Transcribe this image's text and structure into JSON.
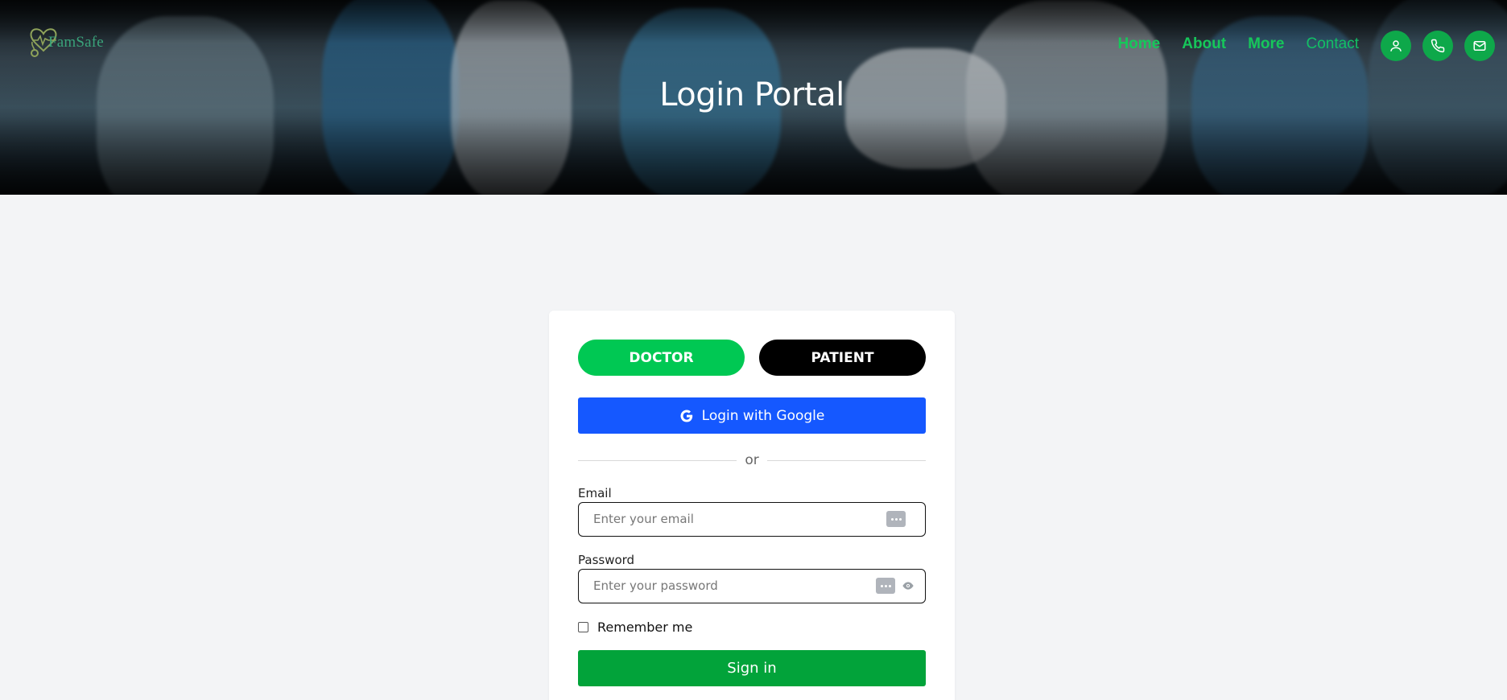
{
  "header": {
    "logo_text": "FamSafe",
    "nav": [
      {
        "label": "Home"
      },
      {
        "label": "About"
      },
      {
        "label": "More"
      },
      {
        "label": "Contact"
      }
    ],
    "icons": [
      "user-icon",
      "phone-icon",
      "mail-icon"
    ],
    "title": "Login Portal"
  },
  "login": {
    "roles": {
      "doctor": "DOCTOR",
      "patient": "PATIENT"
    },
    "google_label": "Login with Google",
    "divider_text": "or",
    "email": {
      "label": "Email",
      "placeholder": "Enter your email"
    },
    "password": {
      "label": "Password",
      "placeholder": "Enter your password"
    },
    "remember_label": "Remember me",
    "submit_label": "Sign in"
  },
  "colors": {
    "nav_green": "#16c75a",
    "doctor_green": "#00c853",
    "google_blue": "#1558ff",
    "signin_green": "#02a33a",
    "background": "#f3f4f6"
  }
}
